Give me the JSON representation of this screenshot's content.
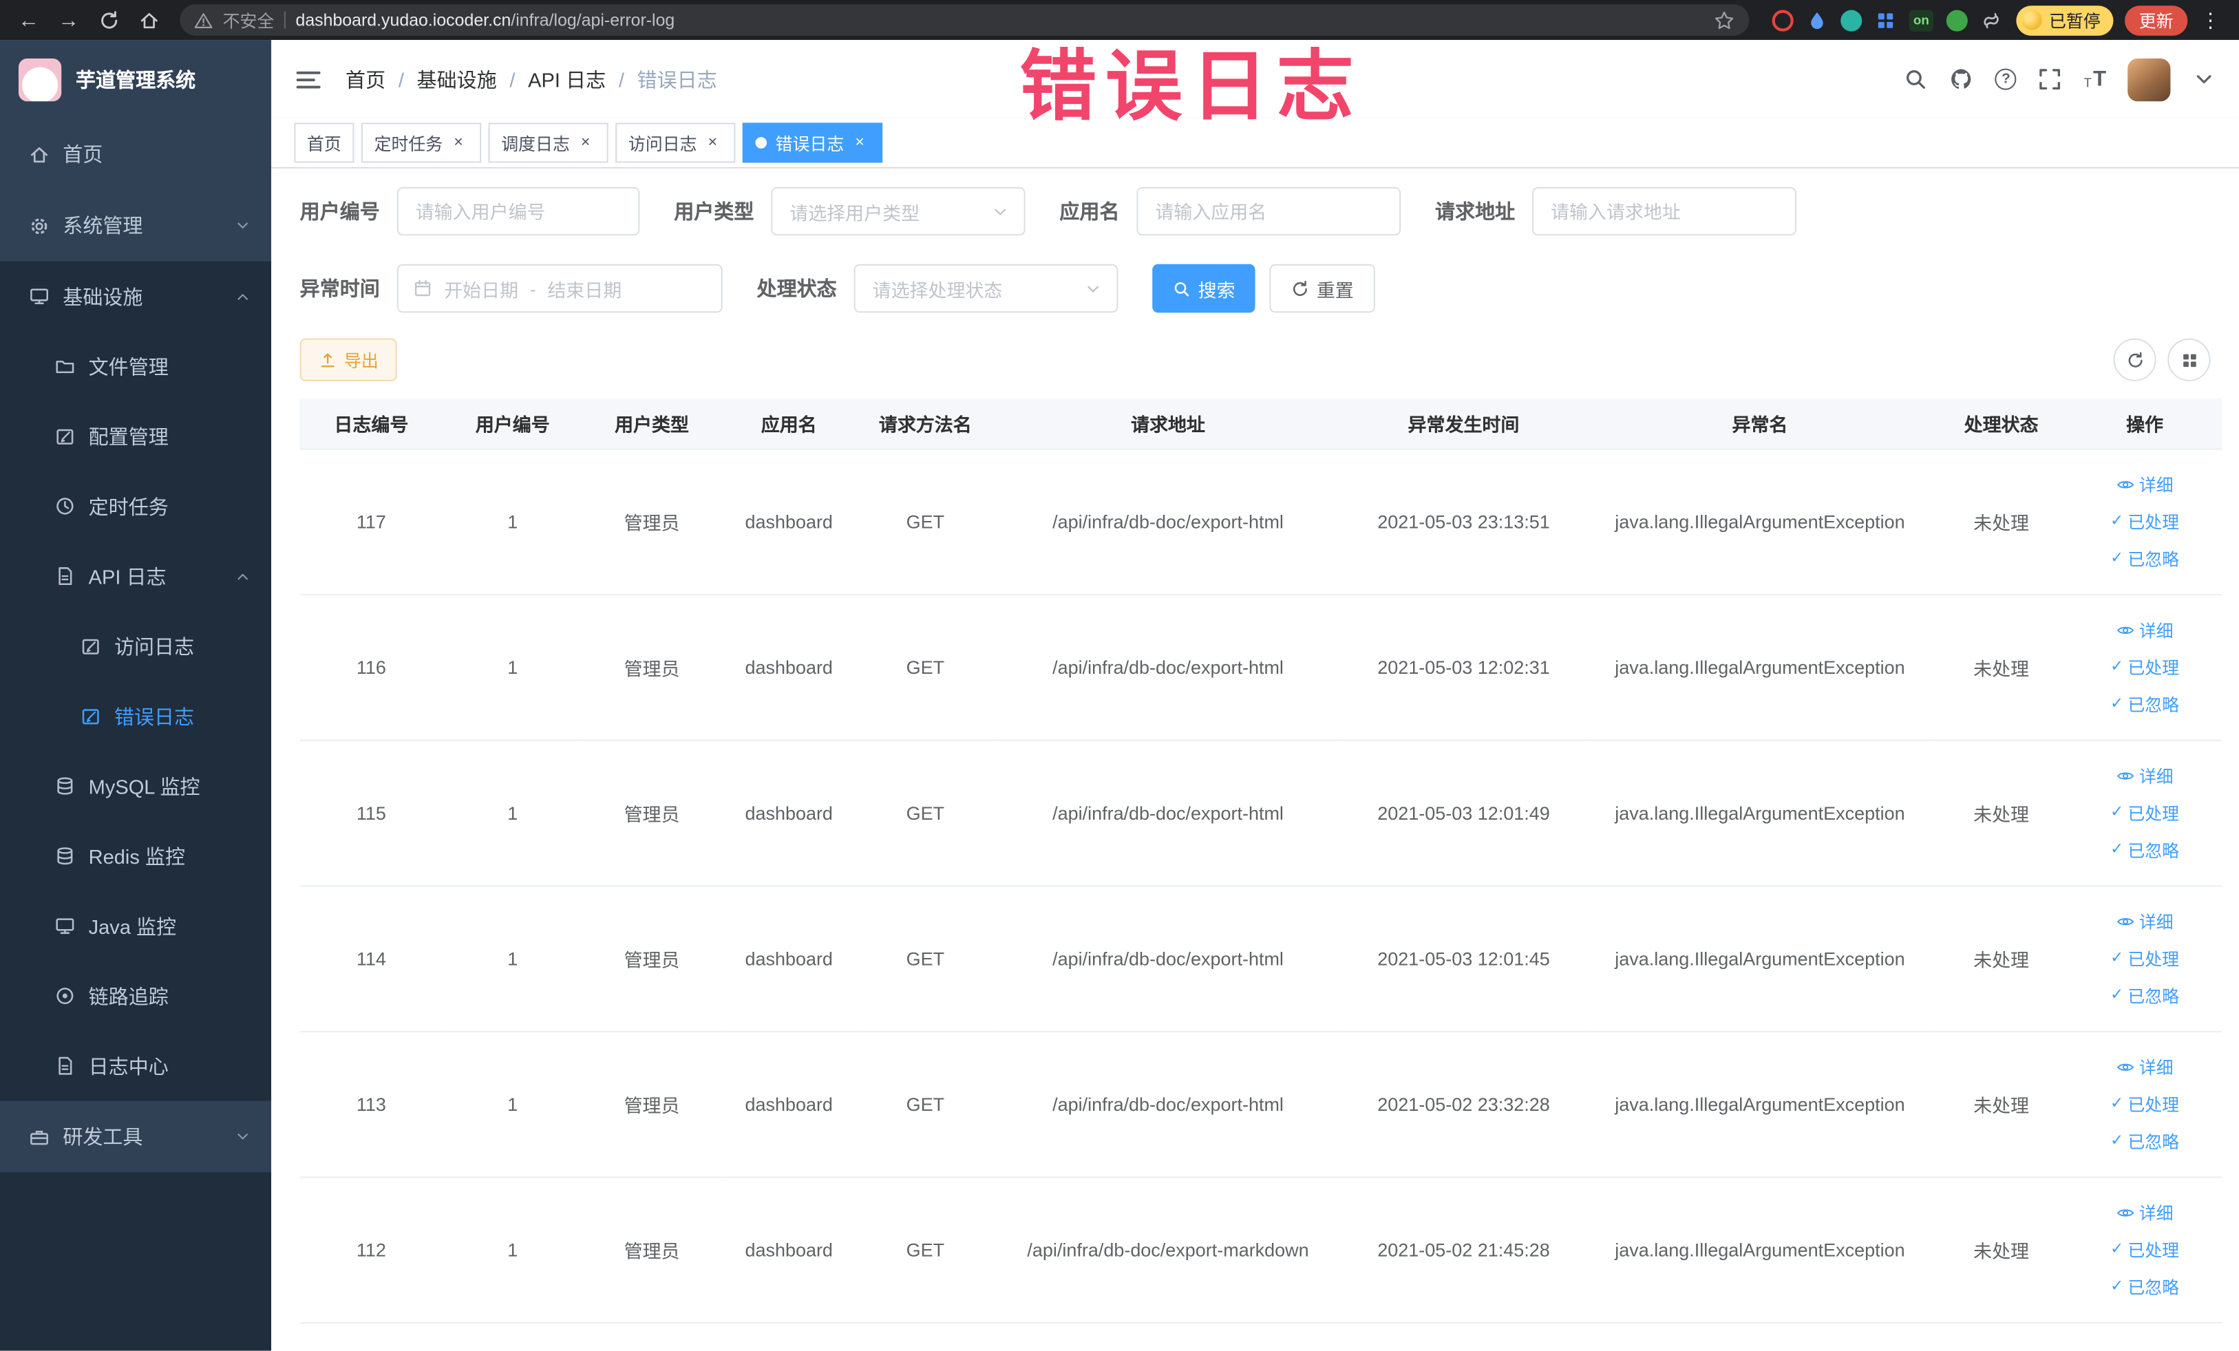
{
  "browser": {
    "security_label": "不安全",
    "url_domain": "dashboard.yudao.iocoder.cn",
    "url_path": "/infra/log/api-error-log",
    "extension_on_label": "on",
    "paused_badge": "已暂停",
    "update_button": "更新"
  },
  "icons": {
    "back": "←",
    "forward": "→",
    "ellipsis": "⋮",
    "help": "?",
    "check": "✓",
    "close": "×",
    "font_small": "T",
    "font_large": "T"
  },
  "annotation": "错误日志",
  "sidebar": {
    "logo_title": "芋道管理系统",
    "items": [
      {
        "label": "首页"
      },
      {
        "label": "系统管理"
      },
      {
        "label": "基础设施"
      },
      {
        "label": "文件管理"
      },
      {
        "label": "配置管理"
      },
      {
        "label": "定时任务"
      },
      {
        "label": "API 日志"
      },
      {
        "label": "访问日志"
      },
      {
        "label": "错误日志"
      },
      {
        "label": "MySQL 监控"
      },
      {
        "label": "Redis 监控"
      },
      {
        "label": "Java 监控"
      },
      {
        "label": "链路追踪"
      },
      {
        "label": "日志中心"
      },
      {
        "label": "研发工具"
      }
    ]
  },
  "breadcrumb": [
    "首页",
    "基础设施",
    "API 日志",
    "错误日志"
  ],
  "breadcrumb_separator": "/",
  "tabs": [
    {
      "label": "首页"
    },
    {
      "label": "定时任务"
    },
    {
      "label": "调度日志"
    },
    {
      "label": "访问日志"
    },
    {
      "label": "错误日志"
    }
  ],
  "filters": {
    "user_id_label": "用户编号",
    "user_id_placeholder": "请输入用户编号",
    "user_type_label": "用户类型",
    "user_type_placeholder": "请选择用户类型",
    "app_name_label": "应用名",
    "app_name_placeholder": "请输入应用名",
    "request_url_label": "请求地址",
    "request_url_placeholder": "请输入请求地址",
    "exception_time_label": "异常时间",
    "date_start_placeholder": "开始日期",
    "date_separator": "-",
    "date_end_placeholder": "结束日期",
    "process_status_label": "处理状态",
    "process_status_placeholder": "请选择处理状态",
    "search_button": "搜索",
    "reset_button": "重置"
  },
  "toolbar": {
    "export_button": "导出"
  },
  "table": {
    "columns": [
      "日志编号",
      "用户编号",
      "用户类型",
      "应用名",
      "请求方法名",
      "请求地址",
      "异常发生时间",
      "异常名",
      "处理状态",
      "操作"
    ],
    "rows": [
      {
        "log_id": "117",
        "user_id": "1",
        "user_type": "管理员",
        "app_name": "dashboard",
        "method": "GET",
        "url": "/api/infra/db-doc/export-html",
        "time": "2021-05-03 23:13:51",
        "exception": "java.lang.IllegalArgumentException",
        "status": "未处理"
      },
      {
        "log_id": "116",
        "user_id": "1",
        "user_type": "管理员",
        "app_name": "dashboard",
        "method": "GET",
        "url": "/api/infra/db-doc/export-html",
        "time": "2021-05-03 12:02:31",
        "exception": "java.lang.IllegalArgumentException",
        "status": "未处理"
      },
      {
        "log_id": "115",
        "user_id": "1",
        "user_type": "管理员",
        "app_name": "dashboard",
        "method": "GET",
        "url": "/api/infra/db-doc/export-html",
        "time": "2021-05-03 12:01:49",
        "exception": "java.lang.IllegalArgumentException",
        "status": "未处理"
      },
      {
        "log_id": "114",
        "user_id": "1",
        "user_type": "管理员",
        "app_name": "dashboard",
        "method": "GET",
        "url": "/api/infra/db-doc/export-html",
        "time": "2021-05-03 12:01:45",
        "exception": "java.lang.IllegalArgumentException",
        "status": "未处理"
      },
      {
        "log_id": "113",
        "user_id": "1",
        "user_type": "管理员",
        "app_name": "dashboard",
        "method": "GET",
        "url": "/api/infra/db-doc/export-html",
        "time": "2021-05-02 23:32:28",
        "exception": "java.lang.IllegalArgumentException",
        "status": "未处理"
      },
      {
        "log_id": "112",
        "user_id": "1",
        "user_type": "管理员",
        "app_name": "dashboard",
        "method": "GET",
        "url": "/api/infra/db-doc/export-markdown",
        "time": "2021-05-02 21:45:28",
        "exception": "java.lang.IllegalArgumentException",
        "status": "未处理"
      }
    ]
  },
  "row_actions": {
    "detail": "详细",
    "processed": "已处理",
    "ignored": "已忽略"
  }
}
